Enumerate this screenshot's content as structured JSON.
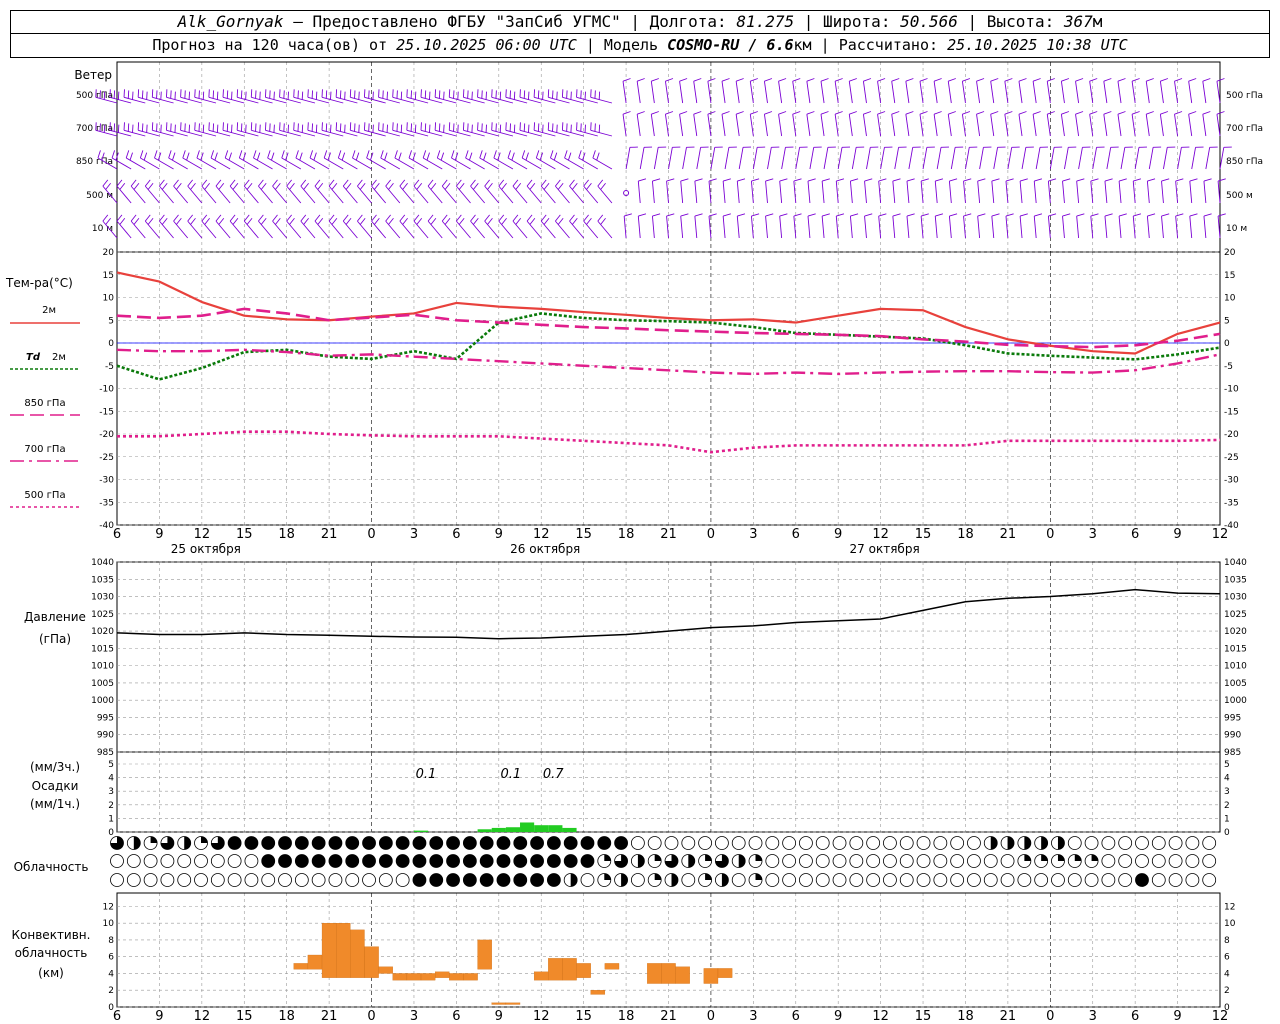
{
  "header": {
    "station": "Alk_Gornyak",
    "provider": "Предоставлено ФГБУ \"ЗапСиб УГМС\"",
    "lon_label": "Долгота:",
    "lon": "81.275",
    "lat_label": "Широта:",
    "lat": "50.566",
    "alt_label": "Высота:",
    "alt": "367",
    "alt_unit": "м",
    "forecast_label": "Прогноз на 120 часа(ов) от",
    "forecast_from": "25.10.2025 06:00 UTC",
    "model_label": "Модель",
    "model": "COSMO-RU / 6.6",
    "model_unit": "км",
    "computed_label": "Рассчитано:",
    "computed": "25.10.2025 10:38 UTC"
  },
  "labels": {
    "wind": "Ветер",
    "temp": "Тем-ра(°C)",
    "t2m": "2м",
    "td": "Td",
    "td_level": "2м",
    "l850": "850 гПа",
    "l700": "700 гПа",
    "l500": "500 гПа",
    "pressure": "Давление",
    "pressure_unit": "(гПа)",
    "precip_3h": "(мм/3ч.)",
    "precip": "Осадки",
    "precip_1h": "(мм/1ч.)",
    "cloud": "Облачность",
    "conv1": "Конвективн.",
    "conv2": "облачность",
    "conv3": "(км)"
  },
  "wind_levels": [
    "500 гПа",
    "700 гПа",
    "850 гПа",
    "500 м",
    "10 м"
  ],
  "hour_ticks": [
    "6",
    "9",
    "12",
    "15",
    "18",
    "21",
    "0",
    "3",
    "6",
    "9",
    "12",
    "15",
    "18",
    "21",
    "0",
    "3",
    "6",
    "9",
    "12",
    "15",
    "18",
    "21",
    "0",
    "3",
    "6",
    "9",
    "12"
  ],
  "date_labels": [
    "25 октября",
    "26 октября",
    "27 октября"
  ],
  "colors": {
    "wind": "#7b00d4",
    "t2m": "#e8413c",
    "td": "#0a7a0a",
    "t850": "#e01e8c",
    "t700": "#e01e8c",
    "t500": "#e01e8c",
    "pressure": "#000000",
    "precip": "#22cc22",
    "conv": "#f08a2a",
    "zero_line": "#0000ff"
  },
  "chart_data": [
    {
      "type": "line",
      "title": "Тем-ра(°C)",
      "x_hours": [
        0,
        3,
        6,
        9,
        12,
        15,
        18,
        21,
        24,
        27,
        30,
        33,
        36,
        39,
        42,
        45,
        48,
        51,
        54,
        57,
        60,
        63,
        66,
        69,
        72,
        75,
        78
      ],
      "ylim": [
        -40,
        20
      ],
      "series": [
        {
          "name": "2м",
          "values": [
            15.5,
            13.5,
            9,
            6,
            5.2,
            5,
            5.8,
            6.5,
            8.8,
            8,
            7.5,
            6.8,
            6.2,
            5.5,
            5,
            5.2,
            4.5,
            6,
            7.5,
            7.2,
            3.5,
            0.8,
            -0.6,
            -1.8,
            -2.3,
            2,
            4.5
          ]
        },
        {
          "name": "Td 2м",
          "values": [
            -5,
            -8,
            -5.5,
            -2,
            -1.5,
            -3,
            -3.5,
            -1.8,
            -3.5,
            4.5,
            6.5,
            5.5,
            5,
            4.8,
            4.5,
            3.5,
            2.2,
            1.8,
            1.4,
            1,
            -0.5,
            -2.3,
            -2.8,
            -3.2,
            -3.6,
            -2.5,
            -1
          ]
        },
        {
          "name": "850 гПа",
          "values": [
            6,
            5.5,
            6,
            7.5,
            6.5,
            5,
            5.6,
            6.2,
            5,
            4.5,
            4,
            3.5,
            3.2,
            2.8,
            2.5,
            2.2,
            2,
            1.8,
            1.5,
            0.8,
            0.3,
            -0.4,
            -0.7,
            -0.9,
            -0.5,
            0.5,
            2
          ]
        },
        {
          "name": "700 гПа",
          "values": [
            -1.5,
            -1.8,
            -1.8,
            -1.5,
            -2,
            -2.8,
            -2.5,
            -3,
            -3.5,
            -4,
            -4.5,
            -5,
            -5.5,
            -6,
            -6.5,
            -6.8,
            -6.5,
            -6.8,
            -6.5,
            -6.3,
            -6.2,
            -6.2,
            -6.4,
            -6.5,
            -6,
            -4.5,
            -2.5
          ]
        },
        {
          "name": "500 гПа",
          "values": [
            -20.5,
            -20.5,
            -20,
            -19.5,
            -19.5,
            -20,
            -20.3,
            -20.5,
            -20.5,
            -20.5,
            -21,
            -21.5,
            -22,
            -22.5,
            -24,
            -23,
            -22.5,
            -22.5,
            -22.5,
            -22.5,
            -22.5,
            -21.5,
            -21.5,
            -21.5,
            -21.5,
            -21.5,
            -21.3
          ]
        }
      ]
    },
    {
      "type": "line",
      "title": "Давление",
      "x_hours": [
        0,
        3,
        6,
        9,
        12,
        15,
        18,
        21,
        24,
        27,
        30,
        33,
        36,
        39,
        42,
        45,
        48,
        51,
        54,
        57,
        60,
        63,
        66,
        69,
        72,
        75,
        78
      ],
      "ylim": [
        985,
        1040
      ],
      "series": [
        {
          "name": "Давление",
          "values": [
            1019.5,
            1019,
            1019,
            1019.5,
            1019,
            1018.8,
            1018.5,
            1018.3,
            1018.2,
            1017.8,
            1018,
            1018.5,
            1019,
            1020,
            1021,
            1021.5,
            1022.5,
            1023,
            1023.5,
            1026,
            1028.5,
            1029.5,
            1030,
            1030.8,
            1032,
            1031,
            1030.8
          ]
        }
      ]
    },
    {
      "type": "bar",
      "title": "Осадки",
      "ylim": [
        0,
        5
      ],
      "annotations": [
        {
          "x_hour": 21,
          "text": "0.1"
        },
        {
          "x_hour": 27,
          "text": "0.1"
        },
        {
          "x_hour": 30,
          "text": "0.7"
        }
      ],
      "bars": [
        {
          "x_hour": 21.5,
          "value": 0.1
        },
        {
          "x_hour": 26,
          "value": 0.2
        },
        {
          "x_hour": 27,
          "value": 0.3
        },
        {
          "x_hour": 28,
          "value": 0.35
        },
        {
          "x_hour": 29,
          "value": 0.7
        },
        {
          "x_hour": 30,
          "value": 0.5
        },
        {
          "x_hour": 31,
          "value": 0.5
        },
        {
          "x_hour": 32,
          "value": 0.3
        }
      ]
    },
    {
      "type": "bar",
      "title": "Конвективн. облачность (км)",
      "ylim": [
        0,
        13
      ],
      "bars": [
        {
          "x_hour": 13,
          "bottom": 4.5,
          "top": 5.2
        },
        {
          "x_hour": 14,
          "bottom": 4.5,
          "top": 6.2
        },
        {
          "x_hour": 15,
          "bottom": 3.5,
          "top": 10
        },
        {
          "x_hour": 16,
          "bottom": 3.5,
          "top": 10
        },
        {
          "x_hour": 17,
          "bottom": 3.5,
          "top": 9.2
        },
        {
          "x_hour": 18,
          "bottom": 3.5,
          "top": 7.2
        },
        {
          "x_hour": 19,
          "bottom": 4.0,
          "top": 4.8
        },
        {
          "x_hour": 20,
          "bottom": 3.2,
          "top": 4.0
        },
        {
          "x_hour": 21,
          "bottom": 3.2,
          "top": 4.0
        },
        {
          "x_hour": 22,
          "bottom": 3.2,
          "top": 4.0
        },
        {
          "x_hour": 23,
          "bottom": 3.5,
          "top": 4.2
        },
        {
          "x_hour": 24,
          "bottom": 3.2,
          "top": 4.0
        },
        {
          "x_hour": 25,
          "bottom": 3.2,
          "top": 4.0
        },
        {
          "x_hour": 26,
          "bottom": 4.5,
          "top": 8.0
        },
        {
          "x_hour": 27,
          "bottom": 0.3,
          "top": 0.5
        },
        {
          "x_hour": 28,
          "bottom": 0.3,
          "top": 0.5
        },
        {
          "x_hour": 30,
          "bottom": 3.2,
          "top": 4.2
        },
        {
          "x_hour": 31,
          "bottom": 3.2,
          "top": 5.8
        },
        {
          "x_hour": 32,
          "bottom": 3.2,
          "top": 5.8
        },
        {
          "x_hour": 33,
          "bottom": 3.5,
          "top": 5.2
        },
        {
          "x_hour": 34,
          "bottom": 1.5,
          "top": 2.0
        },
        {
          "x_hour": 35,
          "bottom": 4.5,
          "top": 5.2
        },
        {
          "x_hour": 38,
          "bottom": 2.8,
          "top": 5.2
        },
        {
          "x_hour": 39,
          "bottom": 2.8,
          "top": 5.2
        },
        {
          "x_hour": 40,
          "bottom": 2.8,
          "top": 4.8
        },
        {
          "x_hour": 42,
          "bottom": 2.8,
          "top": 4.6
        },
        {
          "x_hour": 43,
          "bottom": 3.5,
          "top": 4.6
        }
      ]
    }
  ]
}
